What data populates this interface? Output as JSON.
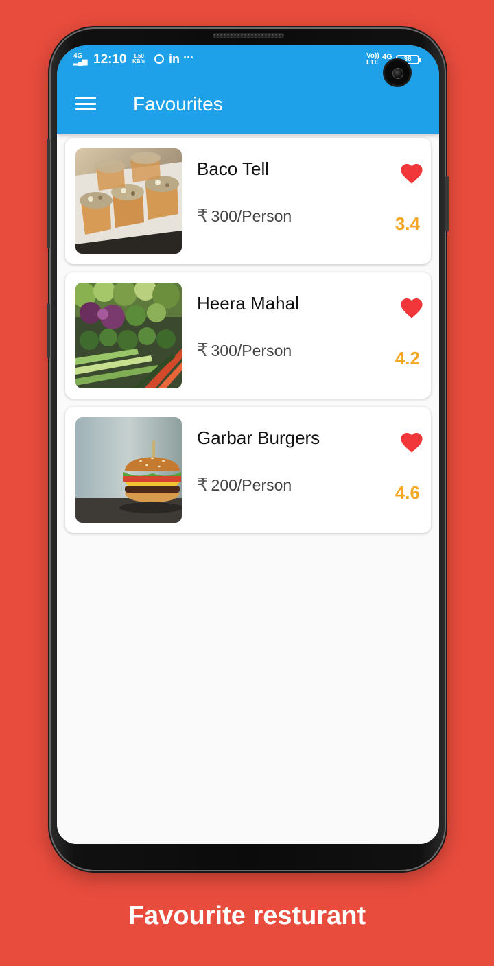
{
  "status_bar": {
    "network": "4G",
    "time": "12:10",
    "speed_value": "1.50",
    "speed_unit": "KB/s",
    "linkedin": "in",
    "more": "···",
    "volte_top": "Vo))",
    "volte_bottom": "LTE",
    "network_right": "4G",
    "battery": "38"
  },
  "app_bar": {
    "title": "Favourites",
    "menu_icon": "hamburger-menu-icon"
  },
  "restaurants": [
    {
      "name": "Baco Tell",
      "currency": "₹",
      "price": "300/Person",
      "rating": "3.4",
      "favourite": true,
      "image": "taco-cups-photo"
    },
    {
      "name": "Heera Mahal",
      "currency": "₹",
      "price": "300/Person",
      "rating": "4.2",
      "favourite": true,
      "image": "vegetables-photo"
    },
    {
      "name": "Garbar Burgers",
      "currency": "₹",
      "price": "200/Person",
      "rating": "4.6",
      "favourite": true,
      "image": "burger-photo"
    }
  ],
  "caption": "Favourite resturant",
  "colors": {
    "background": "#e84c3d",
    "app_bar": "#1ea1e8",
    "heart": "#f2373a",
    "rating": "#f5a623"
  }
}
